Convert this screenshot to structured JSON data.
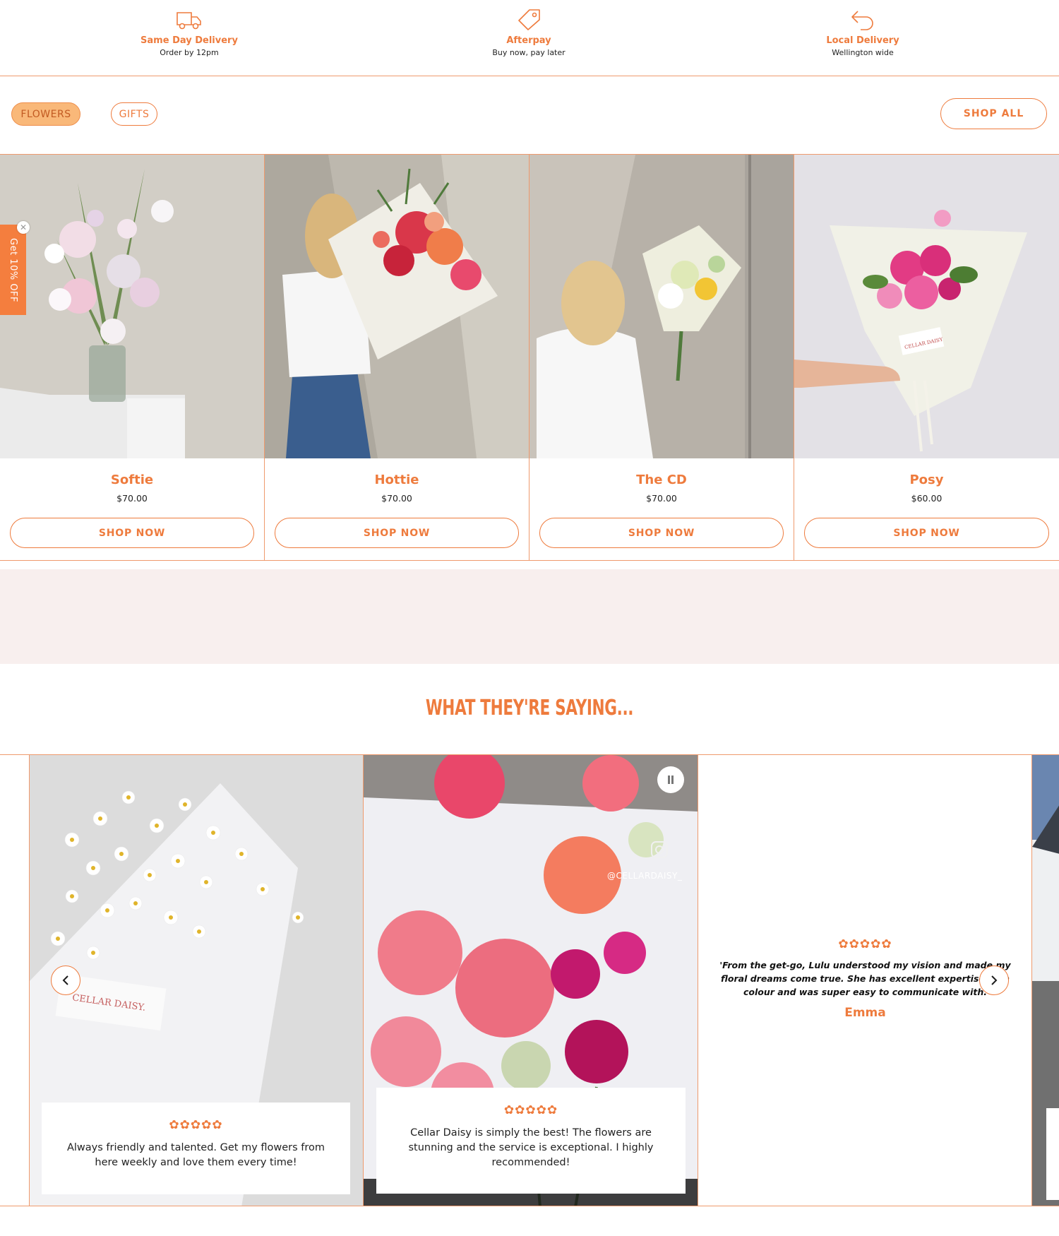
{
  "features": [
    {
      "icon": "truck-icon",
      "title": "Same Day Delivery",
      "subtitle": "Order by 12pm"
    },
    {
      "icon": "tag-icon",
      "title": "Afterpay",
      "subtitle": "Buy now, pay later"
    },
    {
      "icon": "return-arrow-icon",
      "title": "Local Delivery",
      "subtitle": "Wellington wide"
    }
  ],
  "filters": {
    "flowers": "FLOWERS",
    "gifts": "GIFTS",
    "shop_all": "SHOP ALL"
  },
  "products": [
    {
      "name": "Softie",
      "price": "$70.00",
      "button": "SHOP NOW"
    },
    {
      "name": "Hottie",
      "price": "$70.00",
      "button": "SHOP NOW"
    },
    {
      "name": "The CD",
      "price": "$70.00",
      "button": "SHOP NOW"
    },
    {
      "name": "Posy",
      "price": "$60.00",
      "button": "SHOP NOW"
    }
  ],
  "discount_tab": {
    "label": "Get 10% OFF",
    "close": "✕"
  },
  "testimonials": {
    "heading": "WHAT THEY'RE SAYING...",
    "stars": "✿✿✿✿✿",
    "items": [
      {
        "text": "Always friendly and talented. Get my flowers from here weekly and love them every time!"
      },
      {
        "text": "Cellar Daisy is simply the best! The flowers are stunning and the service is exceptional. I highly recommended!"
      },
      {
        "quote": "'From the get-go, Lulu understood my vision and made my floral dreams come true. She has excellent expertise with colour and was super easy to communicate with.",
        "name": "Emma"
      }
    ],
    "handle": "@CELLARDAISY_",
    "wrap_label": "CELLAR DAISY.",
    "card_label": "CELLAR DAISY"
  },
  "colors": {
    "accent": "#ee7b3d",
    "pink_band": "#f8efee",
    "pill_active": "#f9b879"
  }
}
